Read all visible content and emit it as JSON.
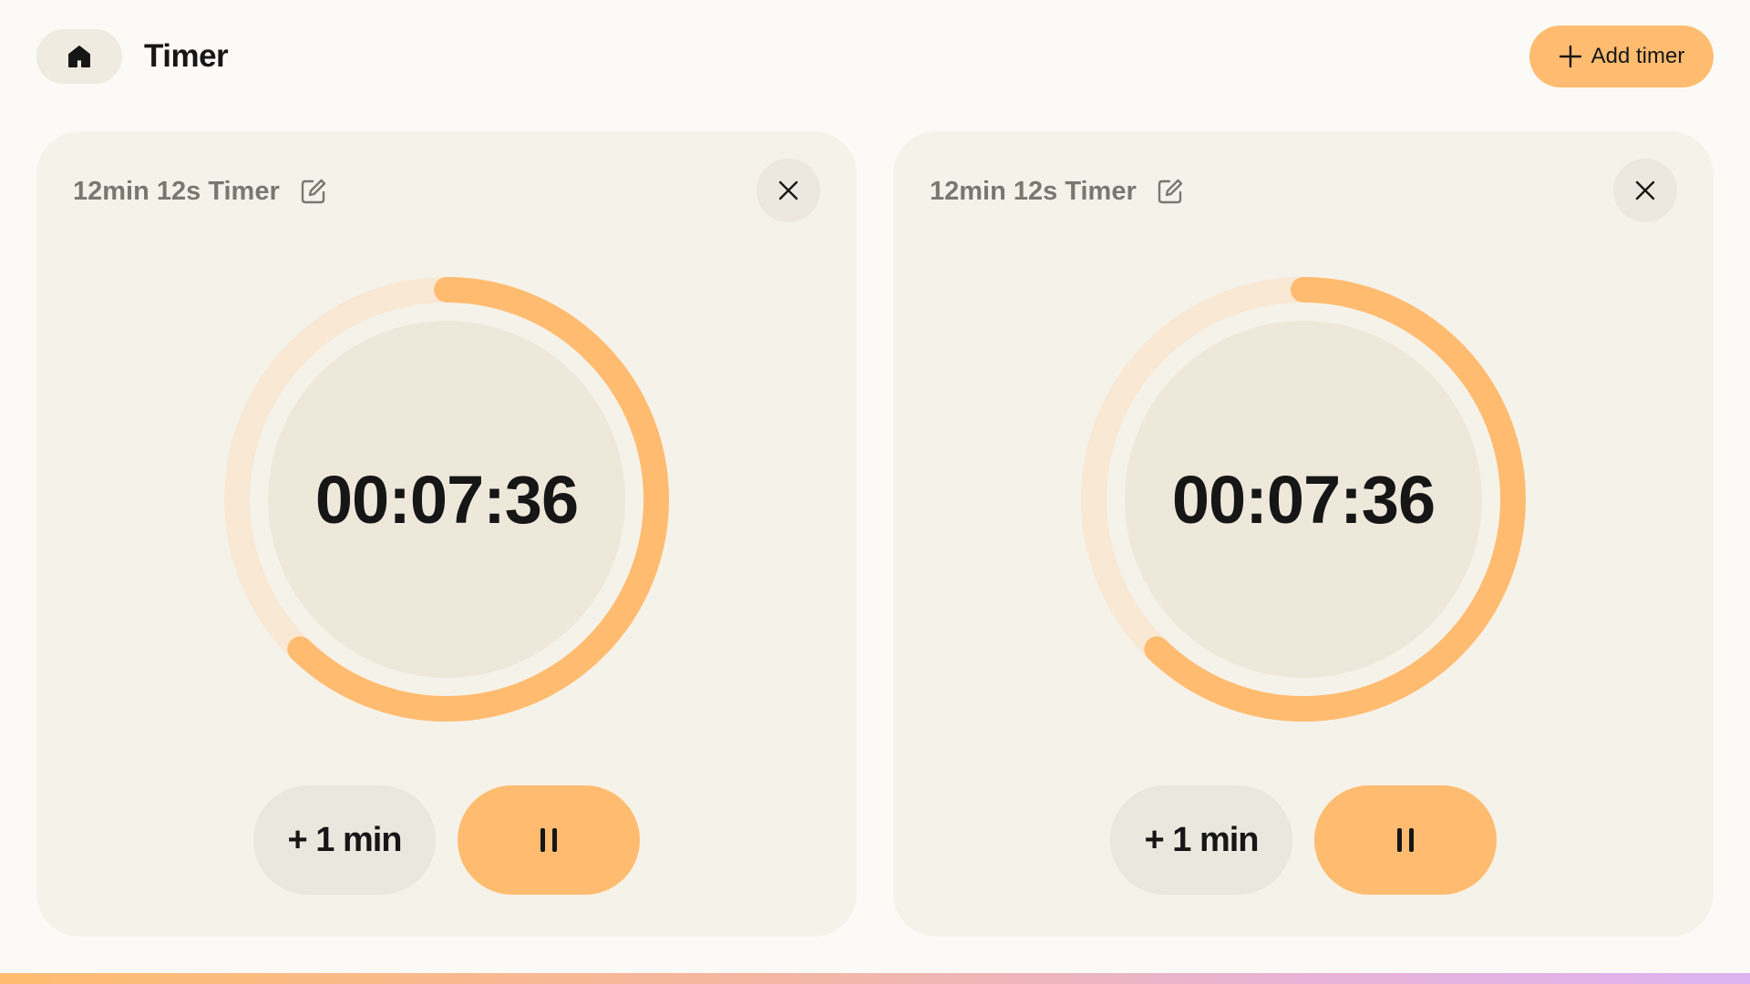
{
  "header": {
    "home_icon": "home-icon",
    "title": "Timer",
    "add_timer_label": "Add timer",
    "add_timer_icon": "plus-icon"
  },
  "colors": {
    "accent": "#FFBC70",
    "track": "#F8E8D4",
    "card_bg": "#F5F2EA",
    "page_bg": "#FCFAF6",
    "text": "#161616",
    "muted_text": "#7B7770"
  },
  "timers": [
    {
      "title": "12min 12s Timer",
      "time_display": "00:07:36",
      "progress_remaining": 0.623,
      "add_minute_label": "+ 1 min",
      "edit_icon": "edit-icon",
      "close_icon": "close-icon",
      "pause_icon": "pause-icon"
    },
    {
      "title": "12min 12s Timer",
      "time_display": "00:07:36",
      "progress_remaining": 0.623,
      "add_minute_label": "+ 1 min",
      "edit_icon": "edit-icon",
      "close_icon": "close-icon",
      "pause_icon": "pause-icon"
    }
  ]
}
